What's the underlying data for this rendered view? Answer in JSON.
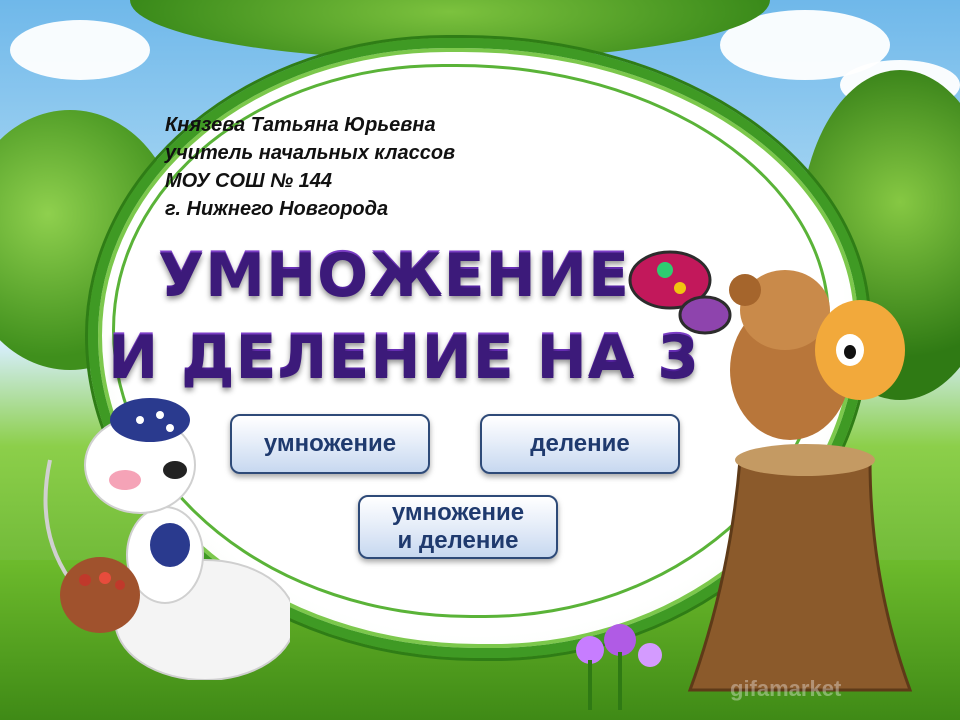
{
  "author": {
    "name": "Князева Татьяна Юрьевна",
    "position": "учитель начальных классов",
    "school": "МОУ СОШ № 144",
    "city": "г. Нижнего Новгорода"
  },
  "title": {
    "line1": "УМНОЖЕНИЕ",
    "line2": "И ДЕЛЕНИЕ НА 3"
  },
  "buttons": {
    "multiplication": "умножение",
    "division": "деление",
    "both_line1": "умножение",
    "both_line2": "и деление"
  },
  "watermark": "gifamarket",
  "colors": {
    "title": "#6a2fbf",
    "frame": "#3f9a24",
    "button_text": "#1f3a6e",
    "button_border": "#2e4a78"
  }
}
